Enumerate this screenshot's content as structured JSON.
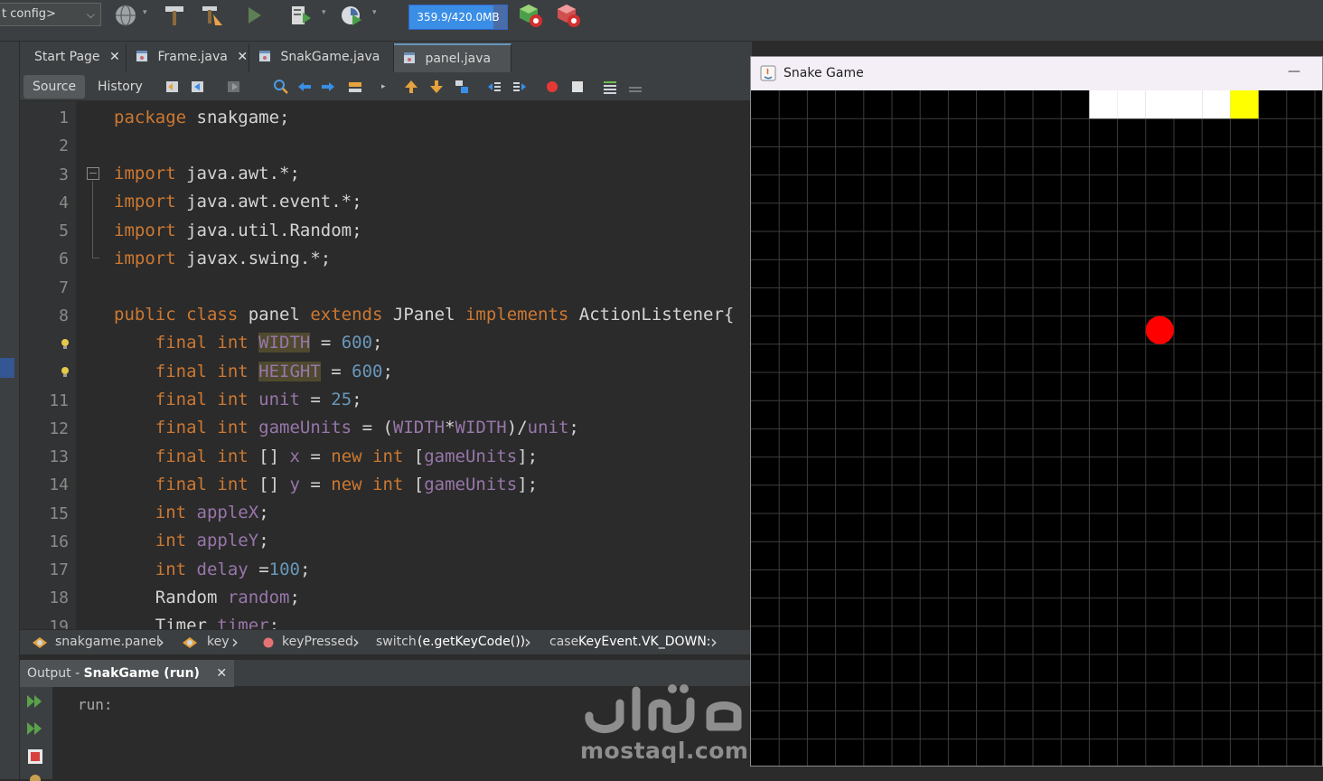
{
  "toolbar": {
    "config_label": "t config>",
    "memory_text": "359.9/420.0MB",
    "memory_used_mb": 359.9,
    "memory_total_mb": 420.0
  },
  "editor_tabs": [
    {
      "label": "Start Page",
      "active": false
    },
    {
      "label": "Frame.java",
      "active": false
    },
    {
      "label": "SnakGame.java",
      "active": false
    },
    {
      "label": "panel.java",
      "active": true
    }
  ],
  "editor_toolbar": {
    "source_label": "Source",
    "history_label": "History"
  },
  "code": {
    "line_numbers": [
      "1",
      "2",
      "3",
      "4",
      "5",
      "6",
      "7",
      "8",
      "",
      "",
      "11",
      "12",
      "13",
      "14",
      "15",
      "16",
      "17",
      "18",
      "19"
    ]
  },
  "breadcrumb": {
    "items": [
      "snakgame.panel",
      "key",
      "keyPressed",
      "switch",
      "(e.getKeyCode())",
      "case",
      "KeyEvent.VK_DOWN:"
    ]
  },
  "output": {
    "tab_prefix": "Output - ",
    "tab_title": "SnakGame (run)",
    "run_text": "run:"
  },
  "watermark": {
    "text": "mostaql.com"
  },
  "snake_window": {
    "title": "Snake Game",
    "colors": {
      "background": "#000000",
      "grid": "#3d3d3d",
      "head": "#ffff00",
      "body": "#ffffff",
      "apple": "#ff0000"
    }
  },
  "colors": {
    "keyword": "#cc7832",
    "variable": "#9876aa",
    "number": "#6897bb",
    "text": "#d4d4d4"
  }
}
